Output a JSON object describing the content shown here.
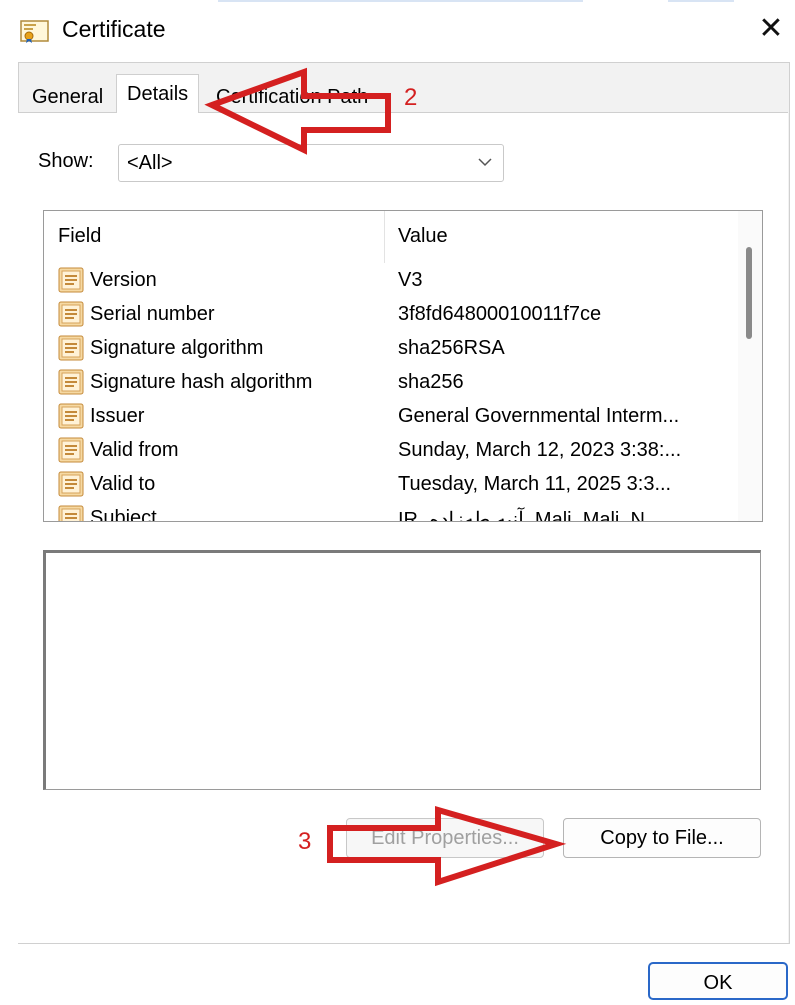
{
  "window": {
    "title": "Certificate",
    "icon": "certificate-icon",
    "close_glyph": "✕"
  },
  "tabs": [
    {
      "label": "General",
      "active": false
    },
    {
      "label": "Details",
      "active": true
    },
    {
      "label": "Certification Path",
      "active": false
    }
  ],
  "show": {
    "label": "Show:",
    "value": "<All>"
  },
  "fields_table": {
    "headers": {
      "field": "Field",
      "value": "Value"
    },
    "rows": [
      {
        "field": "Version",
        "value": "V3"
      },
      {
        "field": "Serial number",
        "value": "3f8fd64800010011f7ce"
      },
      {
        "field": "Signature algorithm",
        "value": "sha256RSA"
      },
      {
        "field": "Signature hash algorithm",
        "value": "sha256"
      },
      {
        "field": "Issuer",
        "value": "General Governmental Interm..."
      },
      {
        "field": "Valid from",
        "value": "Sunday, March 12, 2023 3:38:..."
      },
      {
        "field": "Valid to",
        "value": "Tuesday, March 11, 2025 3:3..."
      },
      {
        "field": "Subject",
        "value": "IR, آنیه طه‌زاده, Mali, Mali, N..."
      }
    ]
  },
  "buttons": {
    "edit_properties": "Edit Properties...",
    "copy_to_file": "Copy to File...",
    "ok": "OK"
  },
  "annotations": {
    "step2": "2",
    "step3": "3",
    "color": "#d42020"
  }
}
